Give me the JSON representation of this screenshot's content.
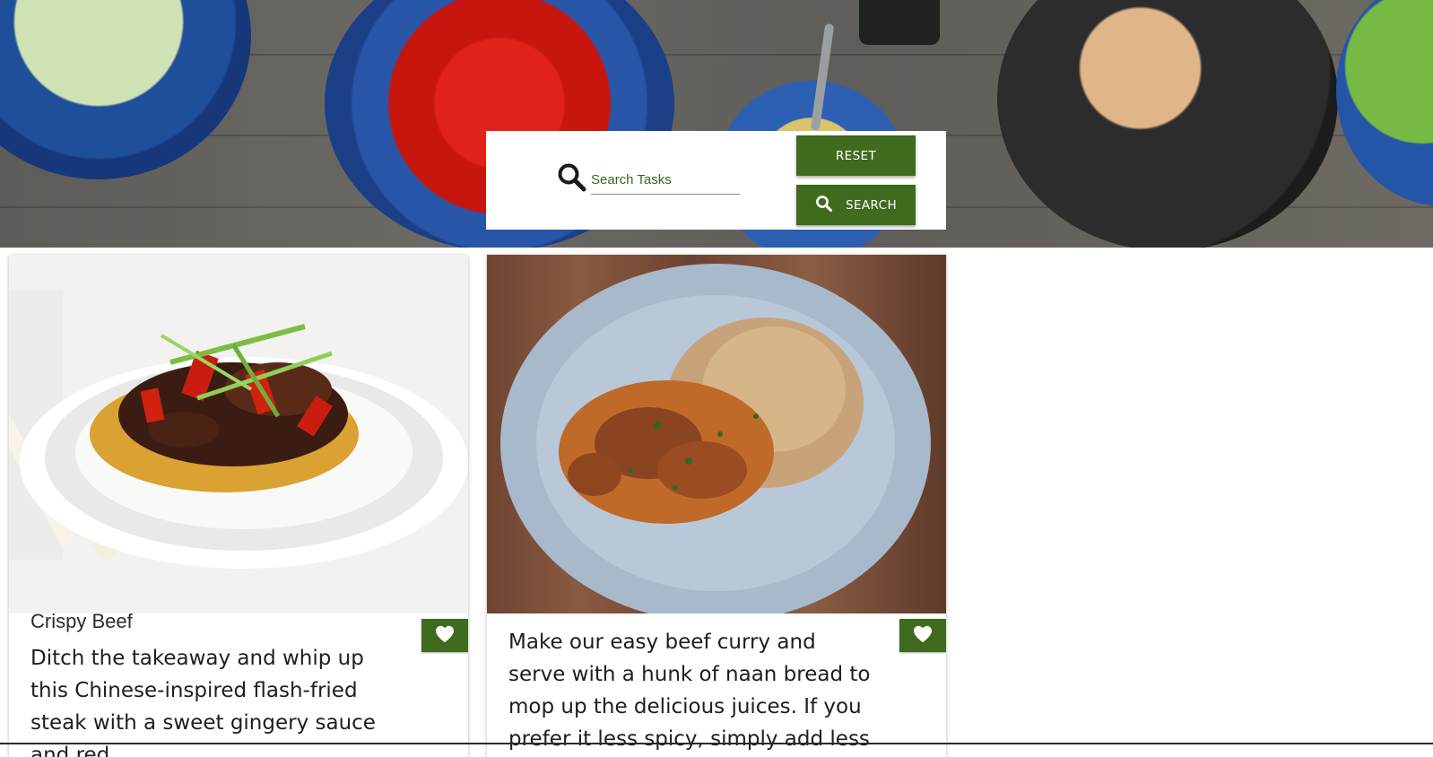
{
  "search": {
    "placeholder": "Search Tasks",
    "reset_label": "RESET",
    "search_label": "SEARCH"
  },
  "colors": {
    "accent": "#3e6b1d",
    "placeholder_text": "#2f6a1a"
  },
  "icons": {
    "search": "search-icon",
    "favorite": "heart-icon"
  },
  "recipes": [
    {
      "title": "Crispy Beef",
      "description": "Ditch the takeaway and whip up this Chinese-inspired flash-fried steak with a sweet gingery sauce and red"
    },
    {
      "title": "",
      "description": "Make our easy beef curry and serve with a hunk of naan bread to mop up the delicious juices. If you prefer it less spicy, simply add less chilli"
    }
  ]
}
